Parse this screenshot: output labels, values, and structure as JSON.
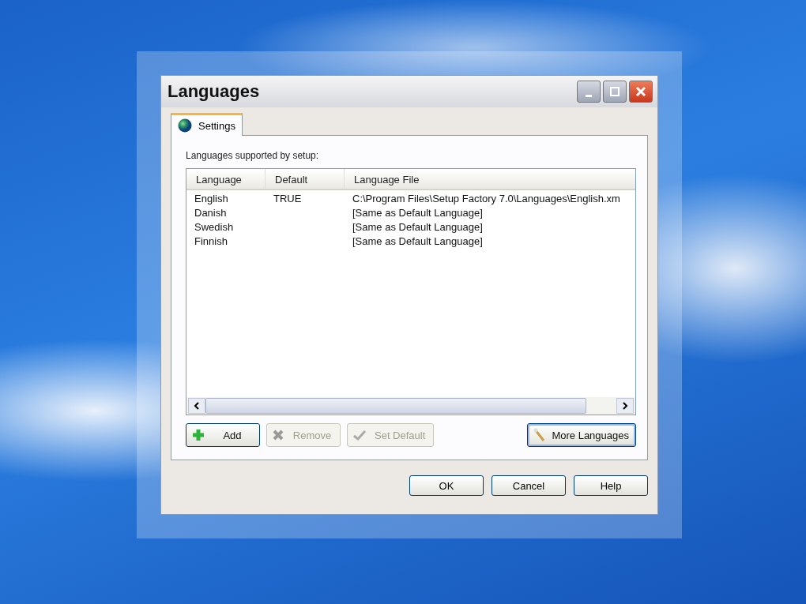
{
  "window": {
    "title": "Languages"
  },
  "tabs": [
    {
      "label": "Settings",
      "selected": true
    }
  ],
  "list_label": "Languages supported by setup:",
  "table": {
    "columns": [
      "Language",
      "Default",
      "Language File"
    ],
    "rows": [
      {
        "cells": [
          "English",
          "TRUE",
          "C:\\Program Files\\Setup Factory 7.0\\Languages\\English.xm"
        ]
      },
      {
        "cells": [
          "Danish",
          "",
          "[Same as Default Language]"
        ]
      },
      {
        "cells": [
          "Swedish",
          "",
          "[Same as Default Language]"
        ]
      },
      {
        "cells": [
          "Finnish",
          "",
          "[Same as Default Language]"
        ]
      }
    ]
  },
  "list_buttons": [
    {
      "label": "Add",
      "kind": "add",
      "disabled": false
    },
    {
      "label": "Remove",
      "kind": "remove",
      "disabled": true
    },
    {
      "label": "Set Default",
      "kind": "check",
      "disabled": true
    }
  ],
  "more_button": {
    "label": "More Languages",
    "focused": true
  },
  "dialog_buttons": [
    "OK",
    "Cancel",
    "Help"
  ]
}
